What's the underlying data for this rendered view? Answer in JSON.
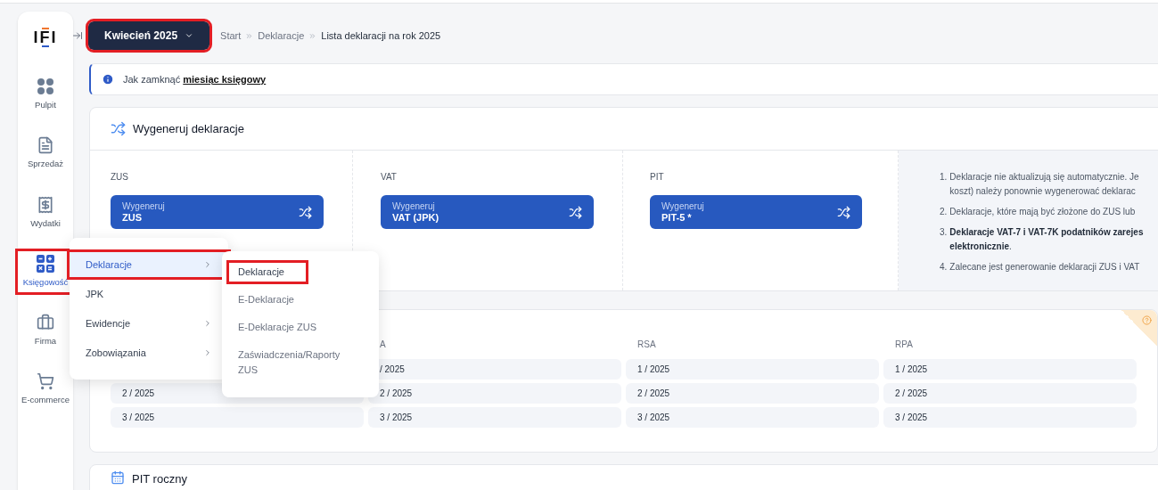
{
  "logo": {
    "text": "IFI"
  },
  "sidebar": {
    "items": [
      {
        "label": "Pulpit",
        "selected": false,
        "highlighted": false
      },
      {
        "label": "Sprzedaż",
        "selected": false,
        "highlighted": false
      },
      {
        "label": "Wydatki",
        "selected": false,
        "highlighted": false
      },
      {
        "label": "Księgowość",
        "selected": true,
        "highlighted": true
      },
      {
        "label": "Firma",
        "selected": false,
        "highlighted": false
      },
      {
        "label": "E-commerce",
        "selected": false,
        "highlighted": false
      }
    ]
  },
  "header": {
    "month_button": {
      "label": "Kwiecień 2025",
      "highlighted": true
    },
    "breadcrumb": [
      {
        "label": "Start",
        "current": false
      },
      {
        "label": "Deklaracje",
        "current": false
      },
      {
        "label": "Lista deklaracji na rok 2025",
        "current": true
      }
    ]
  },
  "info": {
    "text": "Jak zamknąć",
    "link": "miesiąc księgowy"
  },
  "generate_card": {
    "title": "Wygeneruj deklaracje",
    "columns": [
      {
        "label": "ZUS",
        "button": {
          "caption": "Wygeneruj",
          "name": "ZUS"
        }
      },
      {
        "label": "VAT",
        "button": {
          "caption": "Wygeneruj",
          "name": "VAT (JPK)"
        }
      },
      {
        "label": "PIT",
        "button": {
          "caption": "Wygeneruj",
          "name": "PIT-5 *"
        }
      }
    ],
    "notes": [
      {
        "number": "1.",
        "lines": [
          "Deklaracje nie aktualizują się automatycznie. Je",
          "koszt) należy ponownie wygenerować deklarac"
        ]
      },
      {
        "number": "2.",
        "lines": [
          "Deklaracje, które mają być złożone do ZUS lub"
        ]
      },
      {
        "number": "3.",
        "lines": [
          "**Deklaracje VAT-7 i VAT-7K podatników zarejes**",
          "**elektronicznie**."
        ]
      },
      {
        "number": "4.",
        "lines": [
          "Zalecane jest generowanie deklaracji ZUS i VAT"
        ]
      }
    ]
  },
  "list_card": {
    "columns": [
      {
        "cells": [
          "2 / 2025",
          "3 / 2025"
        ]
      },
      {
        "heading": "A",
        "cells": [
          "/ 2025",
          "2 / 2025",
          "3 / 2025"
        ]
      },
      {
        "heading": "RSA",
        "cells": [
          "1 / 2025",
          "2 / 2025",
          "3 / 2025"
        ]
      },
      {
        "heading": "RPA",
        "cells": [
          "1 / 2025",
          "2 / 2025",
          "3 / 2025"
        ]
      }
    ]
  },
  "pit_card": {
    "title": "PIT roczny"
  },
  "menu": {
    "items": [
      {
        "label": "Deklaracje",
        "selected": true,
        "has_submenu": true,
        "highlighted": true
      },
      {
        "label": "JPK",
        "selected": false,
        "has_submenu": false,
        "highlighted": false
      },
      {
        "label": "Ewidencje",
        "selected": false,
        "has_submenu": true,
        "highlighted": false
      },
      {
        "label": "Zobowiązania",
        "selected": false,
        "has_submenu": true,
        "highlighted": false
      }
    ]
  },
  "submenu": {
    "items": [
      {
        "label": "Deklaracje",
        "selected": true,
        "highlighted": true
      },
      {
        "label": "E-Deklaracje",
        "selected": false,
        "highlighted": false
      },
      {
        "label": "E-Deklaracje ZUS",
        "selected": false,
        "highlighted": false
      },
      {
        "label": "Zaświadczenia/Raporty ZUS",
        "selected": false,
        "highlighted": false
      }
    ]
  }
}
